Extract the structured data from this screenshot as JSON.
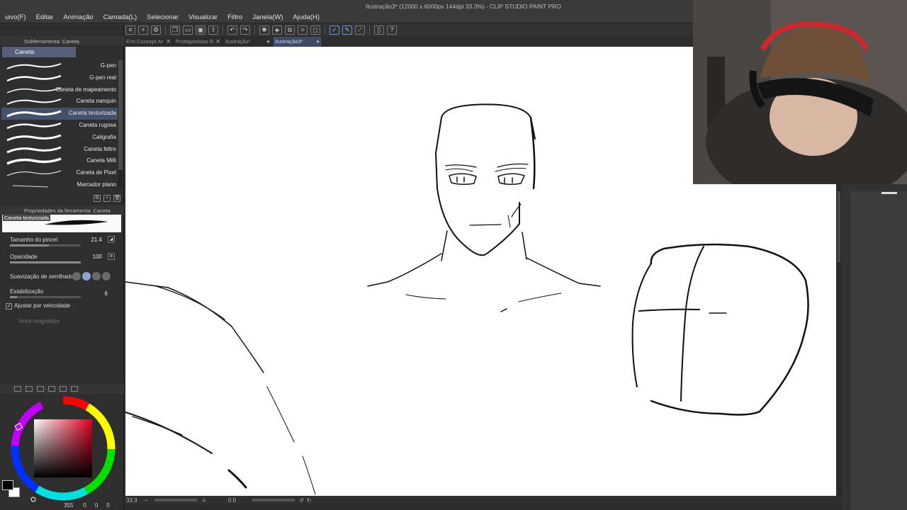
{
  "app": {
    "title": "Ilustração3* (12000 x 6000px 144dpi 33.3%) - CLIP STUDIO PAINT PRO"
  },
  "menu": [
    "uivo(F)",
    "Editar",
    "Animação",
    "Camada(L)",
    "Selecionar",
    "Visualizar",
    "Filtro",
    "Janela(W)",
    "Ajuda(H)"
  ],
  "command_bar": {
    "icons": [
      "menu-icon",
      "new-icon",
      "settings-icon",
      "copy-icon",
      "open-icon",
      "save-icon",
      "export-icon",
      "undo-icon",
      "redo-icon",
      "spinner-icon",
      "fill-icon",
      "transform-icon",
      "crop-icon",
      "deselect-icon",
      "pen-stroke-icon",
      "pen-correct-icon",
      "ruler-icon",
      "device-icon",
      "help-icon"
    ]
  },
  "sub_tool_panel": {
    "header": "Subferramenta: Caneta",
    "group_tab": "Caneta",
    "brushes": [
      {
        "label": "G-pen",
        "selected": false
      },
      {
        "label": "G-pen real",
        "selected": false
      },
      {
        "label": "Caneta de mapeamento",
        "selected": false
      },
      {
        "label": "Caneta nanquin",
        "selected": false
      },
      {
        "label": "Caneta texturizada",
        "selected": true
      },
      {
        "label": "Caneta rugosa",
        "selected": false
      },
      {
        "label": "Caligrafia",
        "selected": false
      },
      {
        "label": "Caneta feltro",
        "selected": false
      },
      {
        "label": "Caneta Milli",
        "selected": false
      },
      {
        "label": "Caneta de Pixel",
        "selected": false
      },
      {
        "label": "Marcador plano",
        "selected": false
      }
    ]
  },
  "tool_properties": {
    "header": "Propriedades da ferramenta: Caneta texturizada",
    "preview_label": "Caneta texturizada",
    "brush_size_label": "Tamanho do pincel",
    "brush_size_value": "21.4",
    "opacity_label": "Opacidade",
    "opacity_value": "100",
    "antialias_label": "Suavização de serrilhado",
    "stabilization_label": "Estabilização",
    "stabilization_value": "6",
    "adjust_speed_label": "Ajustar por velocidade",
    "adjust_speed_checked": true,
    "magnet_label": "Vetor magnético"
  },
  "color": {
    "main": "#000000",
    "sub": "#ffffff",
    "accent": "#8ea4d6"
  },
  "bottom_left": {
    "value_a": "355",
    "value_b": "0",
    "value_c": "0",
    "value_d": "0"
  },
  "doc_tabs": [
    {
      "label": "Emi Concept Ar",
      "active": false
    },
    {
      "label": "Protagonistas R",
      "active": false
    },
    {
      "label": "Ilustração*",
      "active": false
    },
    {
      "label": "Ilustração3*",
      "active": true
    }
  ],
  "status": {
    "zoom": "33.3",
    "angle": "0.0"
  }
}
